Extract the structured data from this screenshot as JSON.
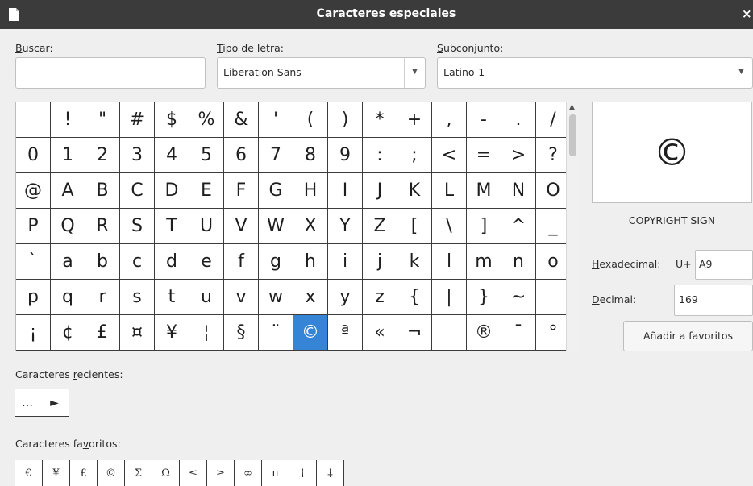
{
  "window": {
    "title": "Caracteres especiales",
    "close_symbol": "×"
  },
  "search": {
    "label_key": "B",
    "label_rest": "uscar:",
    "value": ""
  },
  "font": {
    "label_key": "T",
    "label_rest": "ipo de letra:",
    "value": "Liberation Sans"
  },
  "subset": {
    "label_key": "S",
    "label_rest": "ubconjunto:",
    "value": "Latino-1"
  },
  "grid": {
    "rows": [
      [
        " ",
        "!",
        "\"",
        "#",
        "$",
        "%",
        "&",
        "'",
        "(",
        ")",
        "*",
        "+",
        ",",
        "-",
        ".",
        "/"
      ],
      [
        "0",
        "1",
        "2",
        "3",
        "4",
        "5",
        "6",
        "7",
        "8",
        "9",
        ":",
        ";",
        "<",
        "=",
        ">",
        "?"
      ],
      [
        "@",
        "A",
        "B",
        "C",
        "D",
        "E",
        "F",
        "G",
        "H",
        "I",
        "J",
        "K",
        "L",
        "M",
        "N",
        "O"
      ],
      [
        "P",
        "Q",
        "R",
        "S",
        "T",
        "U",
        "V",
        "W",
        "X",
        "Y",
        "Z",
        "[",
        "\\",
        "]",
        "^",
        "_"
      ],
      [
        "`",
        "a",
        "b",
        "c",
        "d",
        "e",
        "f",
        "g",
        "h",
        "i",
        "j",
        "k",
        "l",
        "m",
        "n",
        "o"
      ],
      [
        "p",
        "q",
        "r",
        "s",
        "t",
        "u",
        "v",
        "w",
        "x",
        "y",
        "z",
        "{",
        "|",
        "}",
        "~",
        ""
      ],
      [
        "¡",
        "¢",
        "£",
        "¤",
        "¥",
        "¦",
        "§",
        "¨",
        "©",
        "ª",
        "«",
        "¬",
        "",
        "®",
        "¯",
        "°"
      ]
    ],
    "selected": {
      "row": 6,
      "col": 8
    }
  },
  "preview": {
    "char": "©",
    "name": "COPYRIGHT SIGN"
  },
  "hex": {
    "label_key": "H",
    "label_rest": "exadecimal:",
    "prefix": "U+",
    "value": "A9"
  },
  "decimal": {
    "label_key": "D",
    "label_rest": "ecimal:",
    "value": "169"
  },
  "add_favorite": {
    "label": "Añadir a favoritos"
  },
  "recent": {
    "label_pre": "Caracteres ",
    "label_key": "r",
    "label_post": "ecientes:",
    "chars": [
      "…",
      "►"
    ]
  },
  "favorites": {
    "label_pre": "Caracteres fa",
    "label_key": "v",
    "label_post": "oritos:",
    "chars": [
      "€",
      "¥",
      "£",
      "©",
      "Σ",
      "Ω",
      "≤",
      "≥",
      "∞",
      "π",
      "†",
      "‡"
    ]
  }
}
